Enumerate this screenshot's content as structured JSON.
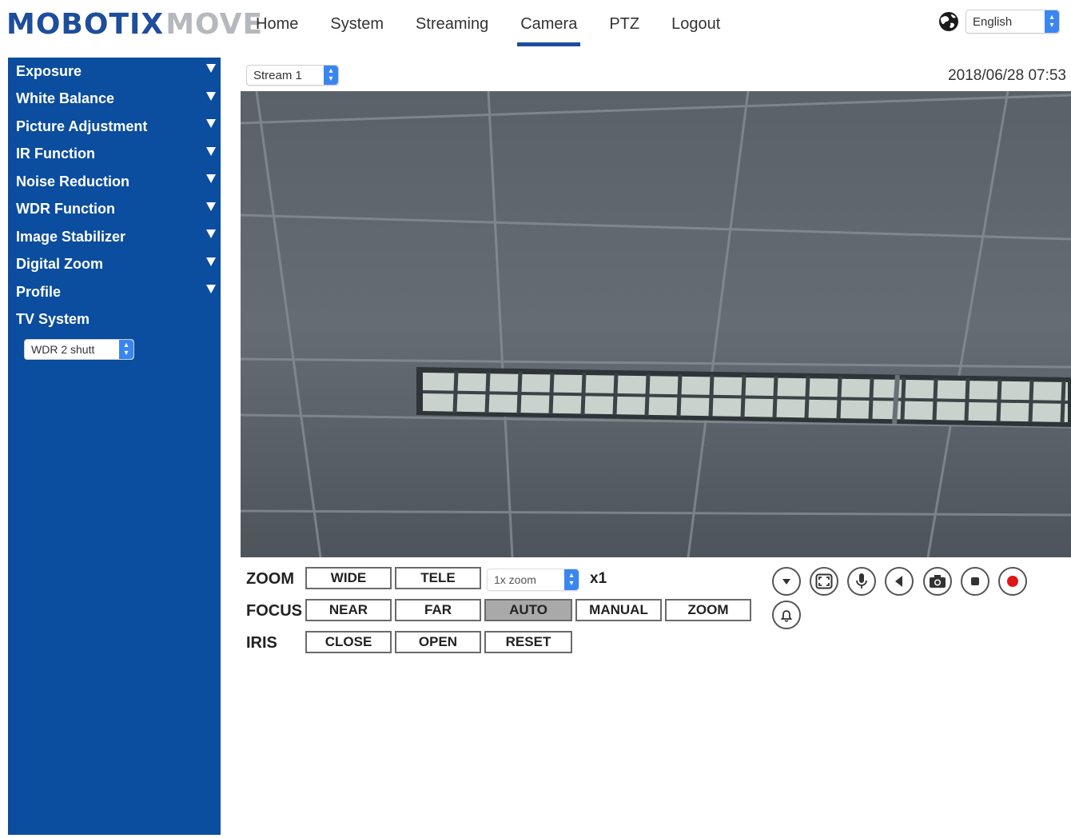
{
  "logo": {
    "part1": "MOBOTIX",
    "part2": "MOVE"
  },
  "nav": [
    {
      "label": "Home"
    },
    {
      "label": "System"
    },
    {
      "label": "Streaming"
    },
    {
      "label": "Camera",
      "active": true
    },
    {
      "label": "PTZ"
    },
    {
      "label": "Logout"
    }
  ],
  "language": {
    "selected": "English"
  },
  "sidebar": {
    "items": [
      {
        "label": "Exposure"
      },
      {
        "label": "White Balance"
      },
      {
        "label": "Picture Adjustment"
      },
      {
        "label": "IR Function"
      },
      {
        "label": "Noise Reduction"
      },
      {
        "label": "WDR Function"
      },
      {
        "label": "Image Stabilizer"
      },
      {
        "label": "Digital Zoom"
      },
      {
        "label": "Profile"
      },
      {
        "label": "TV System"
      }
    ],
    "tv_system_value": "WDR 2 shutt"
  },
  "stream": {
    "selected": "Stream 1"
  },
  "datetime": "2018/06/28 07:53",
  "controls": {
    "zoom": {
      "label": "ZOOM",
      "wide": "WIDE",
      "tele": "TELE",
      "zoom_select": "1x zoom",
      "zoom_level": "x1"
    },
    "focus": {
      "label": "FOCUS",
      "near": "NEAR",
      "far": "FAR",
      "auto": "AUTO",
      "manual": "MANUAL",
      "zoom": "ZOOM"
    },
    "iris": {
      "label": "IRIS",
      "close": "CLOSE",
      "open": "OPEN",
      "reset": "RESET"
    }
  },
  "icons": [
    "dropdown-icon",
    "fullscreen-icon",
    "microphone-icon",
    "speaker-icon",
    "snapshot-icon",
    "stop-icon",
    "record-icon",
    "alarm-bell-icon"
  ],
  "colors": {
    "brand_blue": "#0b4d9e",
    "logo_grey": "#b5b8bd",
    "record_red": "#e01515",
    "select_blue": "#3a86f0"
  }
}
